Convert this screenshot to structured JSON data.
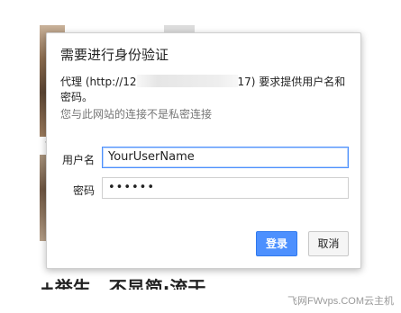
{
  "dialog": {
    "title": "需要进行身份验证",
    "proxy_prefix": "代理 (http://12",
    "proxy_suffix": "17) 要求提供用户名和密码。",
    "privacy_note": "您与此网站的连接不是私密连接",
    "username_label": "用户名",
    "username_value": "YourUserName",
    "password_label": "密码",
    "password_value": "••••••",
    "login_label": "登录",
    "cancel_label": "取消"
  },
  "background": {
    "dash": "-",
    "bottom_text": "+举生，不显简·流于"
  },
  "watermark": "飞网FWvps.COM云主机",
  "colors": {
    "primary_button": "#4d90fe",
    "focus_border": "#4d90fe"
  }
}
